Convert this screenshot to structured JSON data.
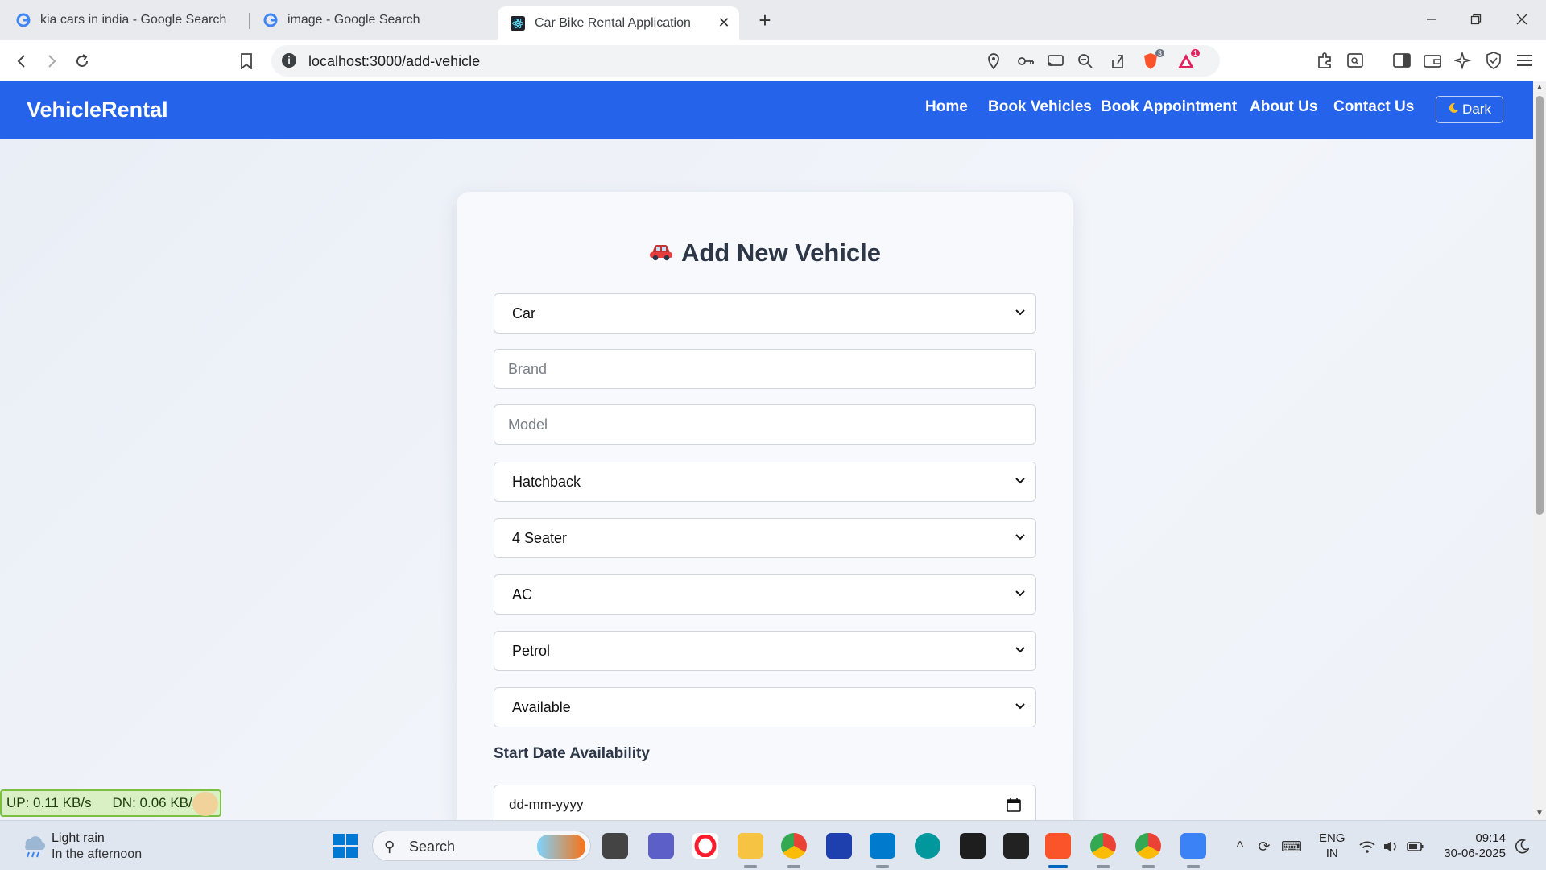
{
  "browser": {
    "tabs": [
      {
        "title": "kia cars in india - Google Search",
        "icon": "google-g-icon"
      },
      {
        "title": "image - Google Search",
        "icon": "google-g-icon"
      },
      {
        "title": "Car Bike Rental Application",
        "icon": "react-icon",
        "active": true
      }
    ],
    "url": "localhost:3000/add-vehicle",
    "brave_shield_count": "3",
    "brave_rewards_count": "1"
  },
  "site": {
    "brand": "VehicleRental",
    "nav": [
      "Home",
      "Book Vehicles",
      "Book Appointment",
      "About Us",
      "Contact Us"
    ],
    "theme_toggle": "Dark",
    "theme_icon": "moon-icon",
    "accent_color": "#2563eb"
  },
  "form": {
    "title": "Add New Vehicle",
    "title_icon": "🚗",
    "vehicle_type": "Car",
    "brand_placeholder": "Brand",
    "model_placeholder": "Model",
    "body_type": "Hatchback",
    "seating": "4 Seater",
    "ac": "AC",
    "fuel": "Petrol",
    "availability": "Available",
    "start_date_label": "Start Date Availability",
    "start_date_placeholder": "dd-mm-yyyy"
  },
  "netmeter": {
    "up": "UP: 0.11 KB/s",
    "down": "DN: 0.06 KB/s"
  },
  "taskbar": {
    "weather_title": "Light rain",
    "weather_sub": "In the afternoon",
    "search_label": "Search",
    "lang_top": "ENG",
    "lang_bottom": "IN",
    "time": "09:14",
    "date": "30-06-2025"
  }
}
